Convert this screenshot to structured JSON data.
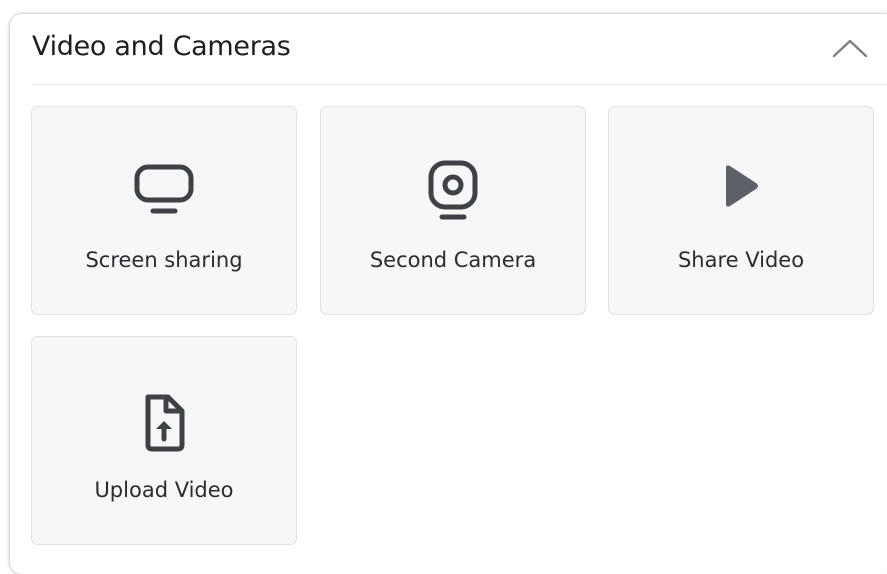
{
  "panel": {
    "title": "Video and Cameras",
    "collapse_icon": "chevron-up-icon"
  },
  "tiles": [
    {
      "label": "Screen sharing",
      "icon": "monitor-icon"
    },
    {
      "label": "Second Camera",
      "icon": "webcam-icon"
    },
    {
      "label": "Share Video",
      "icon": "play-icon"
    },
    {
      "label": "Upload Video",
      "icon": "file-upload-icon"
    }
  ],
  "colors": {
    "icon": "#3e4247",
    "tile_background": "#f6f7f7",
    "tile_border": "#dfe1e2",
    "text": "#1d1e22"
  }
}
